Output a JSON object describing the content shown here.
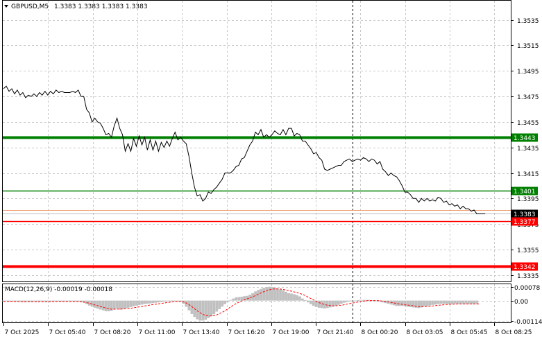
{
  "header": {
    "symbol": "GBPUSD,M5",
    "ohlc": "1.3383 1.3383 1.3383 1.3383"
  },
  "colors": {
    "grid": "#c8c8c8",
    "price_line": "#000000",
    "green_level": "#008000",
    "red_level": "#ff0000",
    "current_price": "#000000",
    "bid_line": "#f0a070",
    "macd_hist": "#c0c0c0",
    "macd_signal": "#ff0000"
  },
  "chart_data": [
    {
      "type": "line",
      "title": "GBPUSD,M5",
      "y_ticks": [
        "1.3535",
        "1.3515",
        "1.3495",
        "1.3475",
        "1.3455",
        "1.3435",
        "1.3415",
        "1.3395",
        "1.3375",
        "1.3355",
        "1.3335"
      ],
      "ylim": [
        1.333,
        1.355
      ],
      "x_ticks": [
        "7 Oct 2025",
        "7 Oct 05:40",
        "7 Oct 08:20",
        "7 Oct 11:00",
        "7 Oct 13:40",
        "7 Oct 16:20",
        "7 Oct 19:00",
        "7 Oct 21:40",
        "8 Oct 00:20",
        "8 Oct 03:05",
        "8 Oct 05:45",
        "8 Oct 08:25"
      ],
      "levels": [
        {
          "label": "1.3443",
          "value": 1.3443,
          "color": "#008000",
          "weight": "thick"
        },
        {
          "label": "1.3401",
          "value": 1.3401,
          "color": "#008000",
          "weight": "thin"
        },
        {
          "label": "1.3383",
          "value": 1.3383,
          "color": "#000000",
          "weight": "current"
        },
        {
          "label": "1.3377",
          "value": 1.3377,
          "color": "#ff0000",
          "weight": "thin"
        },
        {
          "label": "1.3342",
          "value": 1.3342,
          "color": "#ff0000",
          "weight": "thick"
        }
      ],
      "x": [
        0,
        4,
        8,
        12,
        16,
        20,
        24,
        28,
        32,
        36,
        40,
        44,
        48,
        52,
        56,
        60,
        64,
        68,
        72,
        76,
        80,
        84,
        88,
        92,
        96,
        100,
        104,
        108,
        112,
        116,
        120,
        124,
        128,
        132,
        136,
        140,
        144,
        148,
        152,
        156,
        160,
        164,
        168,
        172,
        176,
        180,
        184,
        188,
        192,
        196,
        200,
        204,
        208,
        212,
        216,
        220,
        224,
        228,
        232,
        236,
        240,
        244,
        248,
        252,
        256,
        260,
        264,
        268,
        272,
        276,
        280,
        284,
        288,
        292,
        296,
        300,
        304,
        308,
        312,
        316,
        320,
        324,
        328,
        332,
        336,
        340,
        344,
        348,
        352,
        356,
        360,
        364,
        368,
        372,
        376,
        380,
        384,
        388,
        392,
        396,
        400,
        404,
        408,
        412,
        416,
        420,
        424,
        428,
        432,
        436,
        440,
        444,
        448,
        452,
        456,
        460,
        464,
        468,
        472,
        476,
        480,
        484,
        488,
        492,
        496,
        500,
        504,
        508,
        512,
        516,
        520,
        524,
        528,
        532,
        536,
        540,
        544,
        548,
        552,
        556,
        560,
        564,
        568,
        572,
        576,
        580,
        584,
        588,
        592,
        596,
        600,
        604,
        608,
        612,
        616,
        620,
        624,
        628,
        632,
        636,
        640,
        644,
        648,
        652,
        656,
        660,
        664,
        668,
        672,
        676,
        680,
        684,
        688,
        692,
        696,
        700,
        704,
        708,
        712,
        716,
        720,
        724
      ],
      "series": [
        {
          "values": [
            1.3481,
            1.3483,
            1.3479,
            1.3481,
            1.3477,
            1.348,
            1.3476,
            1.3478,
            1.3474,
            1.3476,
            1.3475,
            1.3477,
            1.3475,
            1.3478,
            1.3476,
            1.3479,
            1.3476,
            1.3479,
            1.3477,
            1.348,
            1.3478,
            1.3479,
            1.3478,
            1.3478,
            1.3478,
            1.3479,
            1.3478,
            1.348,
            1.3475,
            1.3475,
            1.3465,
            1.3462,
            1.3455,
            1.3458,
            1.3455,
            1.3454,
            1.345,
            1.3445,
            1.3446,
            1.3443,
            1.3452,
            1.3458,
            1.345,
            1.3445,
            1.3432,
            1.3438,
            1.3432,
            1.3442,
            1.3436,
            1.3444,
            1.3437,
            1.3443,
            1.3433,
            1.3441,
            1.3433,
            1.344,
            1.3432,
            1.3439,
            1.3435,
            1.344,
            1.3436,
            1.3442,
            1.3447,
            1.3441,
            1.3443,
            1.344,
            1.3438,
            1.3428,
            1.3415,
            1.3404,
            1.3397,
            1.3398,
            1.3393,
            1.3395,
            1.34,
            1.3399,
            1.3402,
            1.3404,
            1.3407,
            1.341,
            1.3415,
            1.3415,
            1.3415,
            1.3417,
            1.342,
            1.3421,
            1.3426,
            1.3427,
            1.3432,
            1.3437,
            1.344,
            1.3447,
            1.3445,
            1.3449,
            1.3443,
            1.3445,
            1.3443,
            1.3445,
            1.3448,
            1.3446,
            1.3445,
            1.3449,
            1.3445,
            1.345,
            1.345,
            1.3444,
            1.3446,
            1.3445,
            1.344,
            1.344,
            1.3437,
            1.3434,
            1.343,
            1.3431,
            1.3427,
            1.3425,
            1.3418,
            1.3417,
            1.3418,
            1.3419,
            1.342,
            1.3421,
            1.3421,
            1.3424,
            1.3425,
            1.3426,
            1.3424,
            1.3425,
            1.3426,
            1.3425,
            1.3427,
            1.3426,
            1.3424,
            1.3426,
            1.3425,
            1.3422,
            1.3424,
            1.3418,
            1.3416,
            1.3413,
            1.3415,
            1.3413,
            1.3412,
            1.3409,
            1.3405,
            1.34,
            1.34,
            1.3398,
            1.3395,
            1.3395,
            1.3392,
            1.3395,
            1.3393,
            1.3395,
            1.3393,
            1.3394,
            1.3393,
            1.3396,
            1.3395,
            1.3392,
            1.3393,
            1.339,
            1.3391,
            1.3389,
            1.339,
            1.3387,
            1.3389,
            1.3387,
            1.3387,
            1.3385,
            1.3386,
            1.3383,
            1.3383,
            1.3383,
            1.3383
          ]
        }
      ]
    },
    {
      "type": "bar",
      "title": "MACD(12,26,9) -0.00019 -0.00018",
      "y_ticks": [
        "0.00078",
        "0.00",
        "-0.00114"
      ],
      "ylim": [
        -0.00122,
        0.00092
      ],
      "x": [
        0,
        4,
        8,
        12,
        16,
        20,
        24,
        28,
        32,
        36,
        40,
        44,
        48,
        52,
        56,
        60,
        64,
        68,
        72,
        76,
        80,
        84,
        88,
        92,
        96,
        100,
        104,
        108,
        112,
        116,
        120,
        124,
        128,
        132,
        136,
        140,
        144,
        148,
        152,
        156,
        160,
        164,
        168,
        172,
        176,
        180,
        184,
        188,
        192,
        196,
        200,
        204,
        208,
        212,
        216,
        220,
        224,
        228,
        232,
        236,
        240,
        244,
        248,
        252,
        256,
        260,
        264,
        268,
        272,
        276,
        280,
        284,
        288,
        292,
        296,
        300,
        304,
        308,
        312,
        316,
        320,
        324,
        328,
        332,
        336,
        340,
        344,
        348,
        352,
        356,
        360,
        364,
        368,
        372,
        376,
        380,
        384,
        388,
        392,
        396,
        400,
        404,
        408,
        412,
        416,
        420,
        424,
        428,
        432,
        436,
        440,
        444,
        448,
        452,
        456,
        460,
        464,
        468,
        472,
        476,
        480,
        484,
        488,
        492,
        496,
        500,
        504,
        508,
        512,
        516,
        520,
        524,
        528,
        532,
        536,
        540,
        544,
        548,
        552,
        556,
        560,
        564,
        568,
        572,
        576,
        580,
        584,
        588,
        592,
        596,
        600,
        604,
        608,
        612,
        616,
        620,
        624,
        628,
        632,
        636,
        640,
        644,
        648,
        652,
        656,
        660,
        664,
        668,
        672,
        676,
        680,
        684,
        688,
        692,
        696,
        700,
        704,
        708,
        712,
        716,
        720,
        724
      ],
      "series": [
        {
          "name": "MACD",
          "values": [
            -4e-05,
            -4e-05,
            -5e-05,
            -5e-05,
            -6e-05,
            -6e-05,
            -7e-05,
            -7e-05,
            -7e-05,
            -7e-05,
            -7e-05,
            -6e-05,
            -6e-05,
            -6e-05,
            -6e-05,
            -5e-05,
            -5e-05,
            -5e-05,
            -5e-05,
            -5e-05,
            -4e-05,
            -4e-05,
            -4e-05,
            -4e-05,
            -5e-05,
            -5e-05,
            -4e-05,
            -4e-05,
            -8e-05,
            -0.00012,
            -0.0002,
            -0.00028,
            -0.00034,
            -0.0004,
            -0.00045,
            -0.0005,
            -0.00055,
            -0.0006,
            -0.0006,
            -0.00057,
            -0.0005,
            -0.00044,
            -0.0005,
            -0.00047,
            -0.00044,
            -0.0004,
            -0.00036,
            -0.00032,
            -0.00028,
            -0.00025,
            -0.00022,
            -0.00019,
            -0.00017,
            -0.00016,
            -0.00014,
            -0.00012,
            -0.0001,
            -8e-05,
            -6e-05,
            -4e-05,
            -2e-05,
            -1e-05,
            0.0,
            -1e-05,
            -6e-05,
            -0.00018,
            -0.00035,
            -0.00055,
            -0.00075,
            -0.00092,
            -0.00105,
            -0.00112,
            -0.00112,
            -0.00108,
            -0.00098,
            -0.00088,
            -0.00076,
            -0.00062,
            -0.00048,
            -0.00034,
            -0.0002,
            -8e-05,
            4e-05,
            0.00012,
            0.00018,
            0.0002,
            0.00022,
            0.00025,
            0.00027,
            0.00033,
            0.00042,
            0.00052,
            0.0006,
            0.00066,
            0.00072,
            0.00076,
            0.00078,
            0.00076,
            0.00072,
            0.00068,
            0.00063,
            0.00058,
            0.0005,
            0.00042,
            0.0004,
            0.00036,
            0.0003,
            0.00024,
            0.00012,
            2e-05,
            -0.0001,
            -0.0002,
            -0.0003,
            -0.00036,
            -0.0004,
            -0.00042,
            -0.00044,
            -0.00042,
            -0.00038,
            -0.00034,
            -0.0003,
            -0.00024,
            -0.00018,
            -0.00012,
            -8e-05,
            -4e-05,
            -2e-05,
            0.0,
            2e-05,
            4e-05,
            4e-05,
            4e-05,
            4e-05,
            2e-05,
            1e-05,
            -2e-05,
            -6e-05,
            -0.0001,
            -0.00014,
            -0.00018,
            -0.00022,
            -0.00026,
            -0.0003,
            -0.0003,
            -0.0003,
            -0.00032,
            -0.00034,
            -0.00036,
            -0.00038,
            -0.0004,
            -0.00042,
            -0.00038,
            -0.00032,
            -0.0003,
            -0.00028,
            -0.00024,
            -0.00022,
            -0.00019,
            -0.00018,
            -0.00018,
            -0.00018,
            -0.00019,
            -0.00019,
            -0.00018,
            -0.00018,
            -0.00018,
            -0.00018,
            -0.00018,
            -0.00019,
            -0.00019,
            -0.00019,
            -0.00019
          ]
        },
        {
          "name": "Signal",
          "values": [
            -4e-05,
            -4e-05,
            -4e-05,
            -4e-05,
            -5e-05,
            -5e-05,
            -5e-05,
            -6e-05,
            -6e-05,
            -6e-05,
            -6e-05,
            -6e-05,
            -6e-05,
            -6e-05,
            -6e-05,
            -6e-05,
            -6e-05,
            -6e-05,
            -5e-05,
            -5e-05,
            -5e-05,
            -5e-05,
            -5e-05,
            -5e-05,
            -5e-05,
            -5e-05,
            -5e-05,
            -5e-05,
            -6e-05,
            -8e-05,
            -0.00011,
            -0.00015,
            -0.00019,
            -0.00024,
            -0.00028,
            -0.00033,
            -0.00037,
            -0.00042,
            -0.00045,
            -0.00048,
            -0.00048,
            -0.00047,
            -0.00048,
            -0.00047,
            -0.00046,
            -0.00045,
            -0.00043,
            -0.0004,
            -0.00038,
            -0.00035,
            -0.00033,
            -0.0003,
            -0.00027,
            -0.00025,
            -0.00022,
            -0.0002,
            -0.00018,
            -0.00016,
            -0.00013,
            -0.00011,
            -9e-05,
            -7e-05,
            -5e-05,
            -4e-05,
            -4e-05,
            -7e-05,
            -0.00013,
            -0.00022,
            -0.00033,
            -0.00045,
            -0.00057,
            -0.00068,
            -0.00077,
            -0.00083,
            -0.00086,
            -0.00086,
            -0.00084,
            -0.0008,
            -0.00073,
            -0.00066,
            -0.00057,
            -0.00047,
            -0.00036,
            -0.00026,
            -0.00017,
            -9e-05,
            -2e-05,
            4e-05,
            0.0001,
            0.00015,
            0.00021,
            0.00028,
            0.00036,
            0.00043,
            0.0005,
            0.00056,
            0.00061,
            0.00064,
            0.00066,
            0.00066,
            0.00065,
            0.00063,
            0.0006,
            0.00056,
            0.00053,
            0.00049,
            0.00045,
            0.00041,
            0.00035,
            0.00028,
            0.0002,
            0.00012,
            4e-05,
            -4e-05,
            -0.00011,
            -0.00017,
            -0.00022,
            -0.00026,
            -0.00028,
            -0.00029,
            -0.00029,
            -0.00028,
            -0.00026,
            -0.00023,
            -0.0002,
            -0.00017,
            -0.00014,
            -0.00011,
            -8e-05,
            -5e-05,
            -3e-05,
            -1e-05,
            0.0,
            0.0,
            0.0,
            0.0,
            -1e-05,
            -3e-05,
            -5e-05,
            -7e-05,
            -0.0001,
            -0.00013,
            -0.00016,
            -0.00019,
            -0.00021,
            -0.00023,
            -0.00025,
            -0.00027,
            -0.00029,
            -0.00031,
            -0.00033,
            -0.00034,
            -0.00034,
            -0.00033,
            -0.00032,
            -0.0003,
            -0.00028,
            -0.00026,
            -0.00025,
            -0.00023,
            -0.00022,
            -0.00021,
            -0.0002,
            -0.0002,
            -0.00019,
            -0.00019,
            -0.00019,
            -0.00019,
            -0.00019,
            -0.00019,
            -0.00019,
            -0.00019,
            -0.00018
          ]
        }
      ]
    }
  ]
}
